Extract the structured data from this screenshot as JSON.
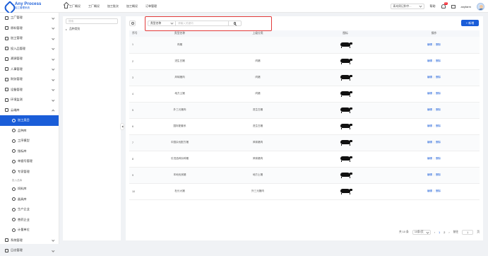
{
  "brand": {
    "title": "Any Process",
    "subtitle": "加工管理系统"
  },
  "topnav": [
    "工厂概况",
    "工厂概况",
    "加工批次",
    "加工概况",
    "订单管理"
  ],
  "header": {
    "company_select": "青岛周记和中...",
    "help": "帮助",
    "notification_count": "10",
    "username": "anyfarm"
  },
  "sidebar": {
    "items": [
      {
        "label": "工厂管理",
        "expand": "down"
      },
      {
        "label": "原料管理",
        "expand": "down"
      },
      {
        "label": "加工管理",
        "expand": "down"
      },
      {
        "label": "投入品管理",
        "expand": "down"
      },
      {
        "label": "溯源管理",
        "expand": "down"
      },
      {
        "label": "人事管理",
        "expand": "down"
      },
      {
        "label": "财务管理",
        "expand": "down"
      },
      {
        "label": "设备管理",
        "expand": "down"
      },
      {
        "label": "环境监测",
        "expand": "down"
      },
      {
        "label": "云端库",
        "expand": "up"
      }
    ],
    "sub_items": [
      "加工类目",
      "品种库",
      "工序模型",
      "指标库",
      "单据号管理",
      "专家管理"
    ],
    "group_label": "投入品库",
    "input_items": [
      "饲料库",
      "器具库",
      "生产企业",
      "兽药企业",
      "计量单位"
    ],
    "bottom_items": [
      {
        "label": "系统管理",
        "expand": "down"
      },
      {
        "label": "日志管理",
        "expand": "down"
      }
    ]
  },
  "tree": {
    "search_placeholder": "搜索",
    "root": "品种类别"
  },
  "search": {
    "field": "类型名称",
    "placeholder": "请输入关键词"
  },
  "add_label": "+ 新增",
  "table": {
    "columns": [
      "序号",
      "类型名称",
      "上级分类",
      "图标",
      "操作"
    ],
    "rows": [
      {
        "idx": "1",
        "name": "肉猪",
        "parent": ""
      },
      {
        "idx": "2",
        "name": "进生白猪",
        "parent": "肉猪"
      },
      {
        "idx": "3",
        "name": "风味猪肉",
        "parent": "肉猪"
      },
      {
        "idx": "4",
        "name": "地方土猪",
        "parent": "肉猪"
      },
      {
        "idx": "5",
        "name": "外三元猪肉",
        "parent": "进生白猪"
      },
      {
        "idx": "6",
        "name": "国际配套系",
        "parent": "进生白猪"
      },
      {
        "idx": "7",
        "name": "中国杂优配方猪",
        "parent": "风味猪肉"
      },
      {
        "idx": "8",
        "name": "引进品种杂种猪",
        "parent": "风味猪肉"
      },
      {
        "idx": "9",
        "name": "本地优良猪",
        "parent": "地方土猪"
      },
      {
        "idx": "10",
        "name": "杜长大猪",
        "parent": "外三元猪肉"
      }
    ],
    "edit_label": "编辑",
    "delete_label": "删除"
  },
  "pagination": {
    "total": "共 10 条",
    "page_size": "10条/页",
    "pages": [
      "1",
      "2"
    ],
    "current": "1",
    "goto_label": "前往",
    "goto_value": "1",
    "page_suffix": "页"
  }
}
